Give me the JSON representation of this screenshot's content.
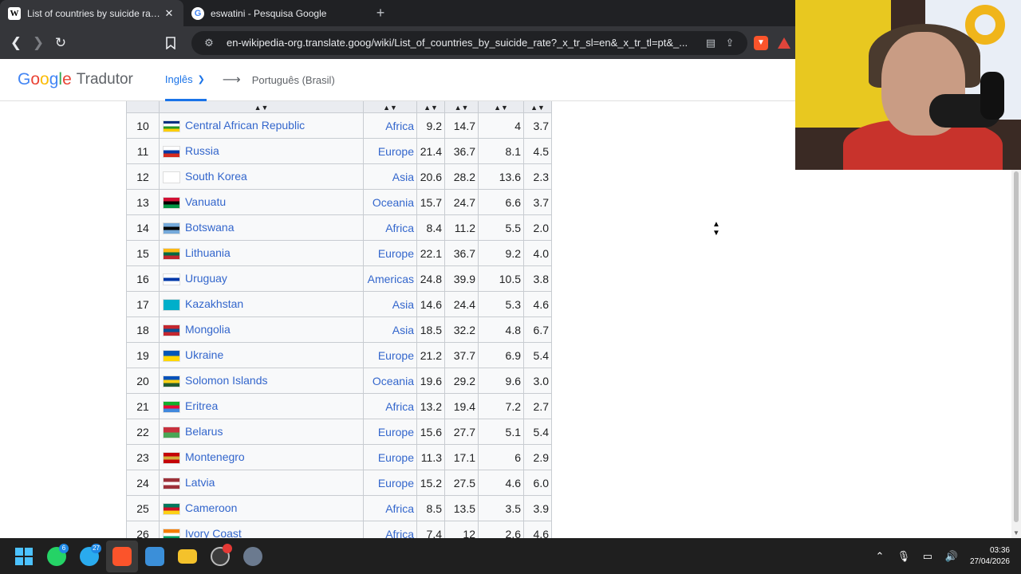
{
  "browser": {
    "tabs": [
      {
        "title": "List of countries by suicide rate - ",
        "favicon": "W",
        "active": true
      },
      {
        "title": "eswatini - Pesquisa Google",
        "favicon": "G",
        "active": false
      }
    ],
    "url": "en-wikipedia-org.translate.goog/wiki/List_of_countries_by_suicide_rate?_x_tr_sl=en&_x_tr_tl=pt&_..."
  },
  "translate_bar": {
    "logo_google": "Google",
    "logo_product": "Tradutor",
    "source_lang": "Inglês",
    "target_lang": "Português (Brasil)"
  },
  "table": {
    "rows": [
      {
        "rank": "10",
        "country": "Central African Republic",
        "region": "Africa",
        "v1": "9.2",
        "v2": "14.7",
        "v3": "4",
        "v4": "3.7",
        "flag": [
          "#003082",
          "#ffffff",
          "#289728",
          "#ffce00"
        ]
      },
      {
        "rank": "11",
        "country": "Russia",
        "region": "Europe",
        "v1": "21.4",
        "v2": "36.7",
        "v3": "8.1",
        "v4": "4.5",
        "flag": [
          "#ffffff",
          "#0039a6",
          "#d52b1e"
        ]
      },
      {
        "rank": "12",
        "country": "South Korea",
        "region": "Asia",
        "v1": "20.6",
        "v2": "28.2",
        "v3": "13.6",
        "v4": "2.3",
        "flag": [
          "#ffffff"
        ]
      },
      {
        "rank": "13",
        "country": "Vanuatu",
        "region": "Oceania",
        "v1": "15.7",
        "v2": "24.7",
        "v3": "6.6",
        "v4": "3.7",
        "flag": [
          "#d21034",
          "#000000",
          "#009543"
        ]
      },
      {
        "rank": "14",
        "country": "Botswana",
        "region": "Africa",
        "v1": "8.4",
        "v2": "11.2",
        "v3": "5.5",
        "v4": "2.0",
        "flag": [
          "#75aadb",
          "#000000",
          "#75aadb"
        ]
      },
      {
        "rank": "15",
        "country": "Lithuania",
        "region": "Europe",
        "v1": "22.1",
        "v2": "36.7",
        "v3": "9.2",
        "v4": "4.0",
        "flag": [
          "#fdb913",
          "#006a44",
          "#c1272d"
        ]
      },
      {
        "rank": "16",
        "country": "Uruguay",
        "region": "Americas",
        "v1": "24.8",
        "v2": "39.9",
        "v3": "10.5",
        "v4": "3.8",
        "flag": [
          "#ffffff",
          "#0038a8",
          "#ffffff"
        ]
      },
      {
        "rank": "17",
        "country": "Kazakhstan",
        "region": "Asia",
        "v1": "14.6",
        "v2": "24.4",
        "v3": "5.3",
        "v4": "4.6",
        "flag": [
          "#00afca"
        ]
      },
      {
        "rank": "18",
        "country": "Mongolia",
        "region": "Asia",
        "v1": "18.5",
        "v2": "32.2",
        "v3": "4.8",
        "v4": "6.7",
        "flag": [
          "#c4272f",
          "#015197",
          "#c4272f"
        ]
      },
      {
        "rank": "19",
        "country": "Ukraine",
        "region": "Europe",
        "v1": "21.2",
        "v2": "37.7",
        "v3": "6.9",
        "v4": "5.4",
        "flag": [
          "#0057b7",
          "#ffd700"
        ]
      },
      {
        "rank": "20",
        "country": "Solomon Islands",
        "region": "Oceania",
        "v1": "19.6",
        "v2": "29.2",
        "v3": "9.6",
        "v4": "3.0",
        "flag": [
          "#0051ba",
          "#fcd116",
          "#215b33"
        ]
      },
      {
        "rank": "21",
        "country": "Eritrea",
        "region": "Africa",
        "v1": "13.2",
        "v2": "19.4",
        "v3": "7.2",
        "v4": "2.7",
        "flag": [
          "#12ad2b",
          "#ea0437",
          "#4189dd"
        ]
      },
      {
        "rank": "22",
        "country": "Belarus",
        "region": "Europe",
        "v1": "15.6",
        "v2": "27.7",
        "v3": "5.1",
        "v4": "5.4",
        "flag": [
          "#c8313e",
          "#4aa657"
        ]
      },
      {
        "rank": "23",
        "country": "Montenegro",
        "region": "Europe",
        "v1": "11.3",
        "v2": "17.1",
        "v3": "6",
        "v4": "2.9",
        "flag": [
          "#c40308",
          "#d3ae3b",
          "#c40308"
        ]
      },
      {
        "rank": "24",
        "country": "Latvia",
        "region": "Europe",
        "v1": "15.2",
        "v2": "27.5",
        "v3": "4.6",
        "v4": "6.0",
        "flag": [
          "#9e3039",
          "#ffffff",
          "#9e3039"
        ]
      },
      {
        "rank": "25",
        "country": "Cameroon",
        "region": "Africa",
        "v1": "8.5",
        "v2": "13.5",
        "v3": "3.5",
        "v4": "3.9",
        "flag": [
          "#007a5e",
          "#ce1126",
          "#fcd116"
        ]
      },
      {
        "rank": "26",
        "country": "Ivory Coast",
        "region": "Africa",
        "v1": "7.4",
        "v2": "12",
        "v3": "2.6",
        "v4": "4.6",
        "flag": [
          "#f77f00",
          "#ffffff",
          "#009e60"
        ]
      }
    ]
  },
  "taskbar": {
    "whatsapp_badge": "6",
    "telegram_badge": "27",
    "clock_time": "03:36",
    "clock_date": "27/04/2026"
  }
}
